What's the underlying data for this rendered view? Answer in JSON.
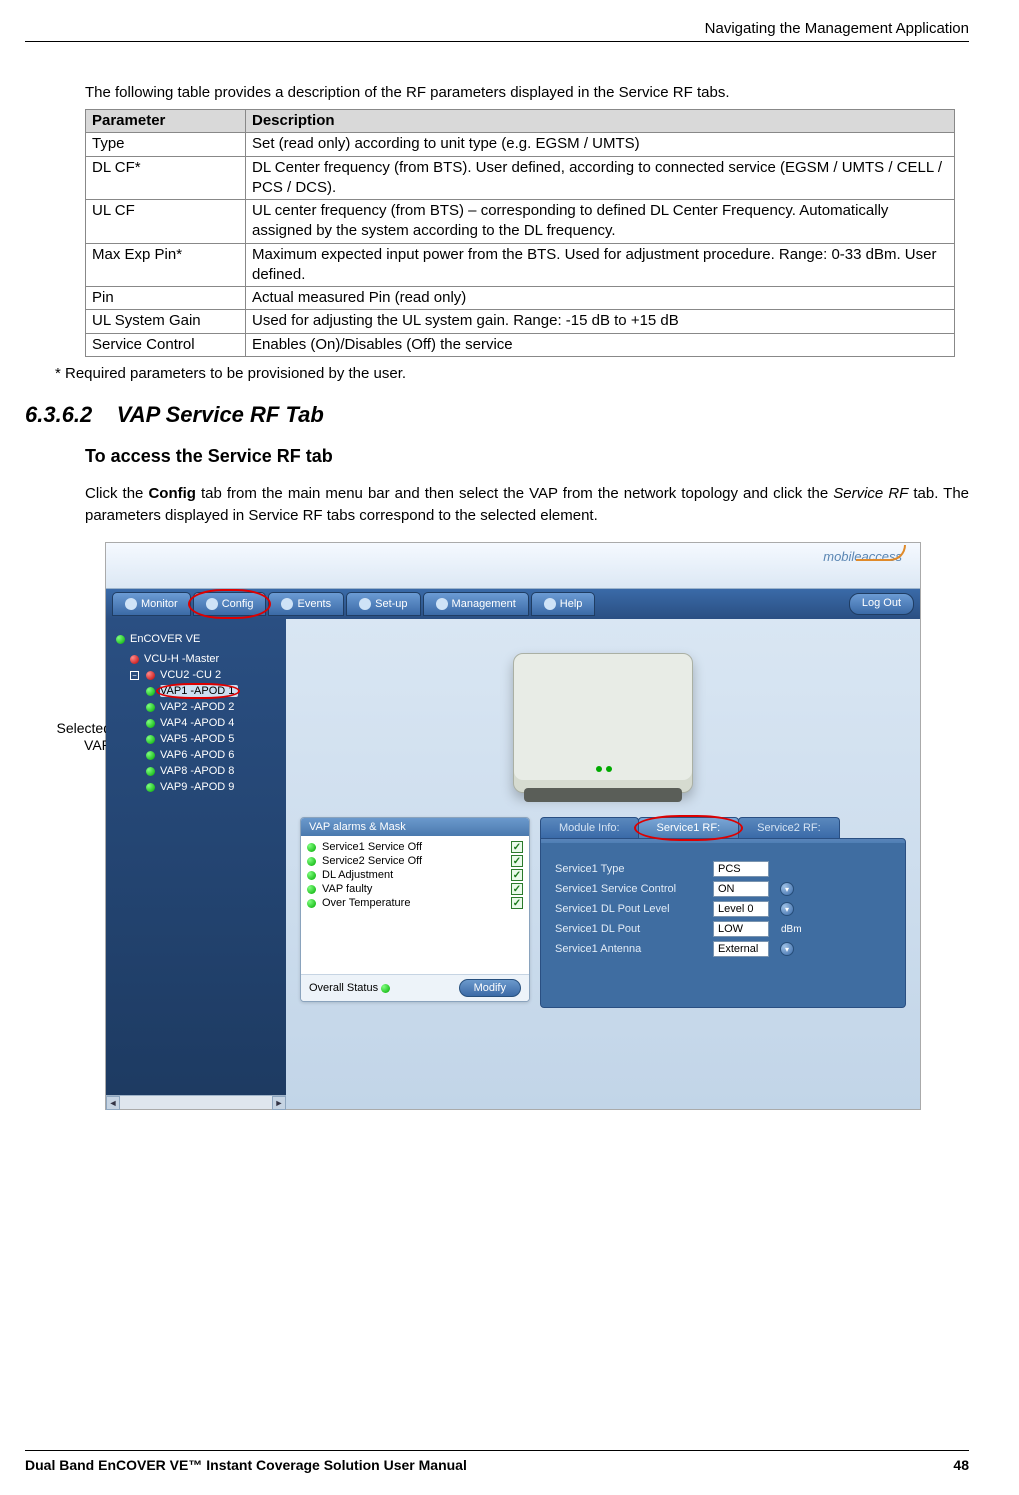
{
  "header": {
    "right": "Navigating the Management Application"
  },
  "intro": "The following table provides a description of the RF parameters displayed in the Service RF tabs.",
  "table": {
    "headers": {
      "param": "Parameter",
      "desc": "Description"
    },
    "rows": [
      {
        "param": "Type",
        "desc": "Set (read only) according to unit type (e.g. EGSM / UMTS)"
      },
      {
        "param": "DL CF*",
        "desc": "DL Center frequency (from BTS). User defined, according to connected service (EGSM / UMTS / CELL / PCS / DCS)."
      },
      {
        "param": "UL CF",
        "desc": "UL center frequency (from BTS) – corresponding to defined DL Center Frequency. Automatically assigned by the system according to the DL frequency."
      },
      {
        "param": "Max Exp Pin*",
        "desc": "Maximum expected input power from the BTS. Used for adjustment procedure. Range: 0-33 dBm. User defined."
      },
      {
        "param": "Pin",
        "desc": "Actual measured Pin (read only)"
      },
      {
        "param": "UL System Gain",
        "desc": "Used for adjusting the UL system gain. Range: -15 dB to +15 dB"
      },
      {
        "param": "Service Control",
        "desc": "Enables (On)/Disables (Off) the service"
      }
    ]
  },
  "footnote": "* Required parameters to be provisioned by the user.",
  "section": {
    "num": "6.3.6.2",
    "title": "VAP Service RF Tab"
  },
  "subhead": "To access the Service RF tab",
  "para": {
    "p1a": "Click the ",
    "p1bold": "Config",
    "p1b": " tab from the main menu bar and then select the VAP from the network topology and click the ",
    "p1it": "Service RF",
    "p1c": " tab. The parameters displayed in Service RF tabs correspond to the selected element."
  },
  "callout": "Selected\nVAP",
  "shot": {
    "logo": "mobileaccess",
    "tabs": [
      "Monitor",
      "Config",
      "Events",
      "Set-up",
      "Management",
      "Help"
    ],
    "logout": "Log Out",
    "tree": {
      "root": "EnCOVER VE",
      "l1a": "VCU-H -Master",
      "l1b": "VCU2 -CU 2",
      "vaps": [
        "VAP1 -APOD 1",
        "VAP2 -APOD 2",
        "VAP4 -APOD 4",
        "VAP5 -APOD 5",
        "VAP6 -APOD 6",
        "VAP8 -APOD 8",
        "VAP9 -APOD 9"
      ]
    },
    "alarms": {
      "header": "VAP alarms & Mask",
      "items": [
        "Service1 Service Off",
        "Service2 Service Off",
        "DL Adjustment",
        "VAP faulty",
        "Over Temperature"
      ],
      "footer_label": "Overall Status",
      "modify": "Modify"
    },
    "module_tabs": [
      "Module Info:",
      "Service1 RF:",
      "Service2 RF:"
    ],
    "info": {
      "rows": [
        {
          "label": "Service1 Type",
          "value": "PCS",
          "dd": false,
          "unit": ""
        },
        {
          "label": "Service1 Service Control",
          "value": "ON",
          "dd": true,
          "unit": ""
        },
        {
          "label": "Service1 DL Pout Level",
          "value": "Level 0",
          "dd": true,
          "unit": ""
        },
        {
          "label": "Service1 DL Pout",
          "value": "LOW",
          "dd": false,
          "unit": "dBm"
        },
        {
          "label": "Service1 Antenna",
          "value": "External",
          "dd": true,
          "unit": ""
        }
      ]
    }
  },
  "footer": {
    "left": "Dual Band EnCOVER VE™ Instant Coverage Solution User Manual",
    "right": "48"
  }
}
